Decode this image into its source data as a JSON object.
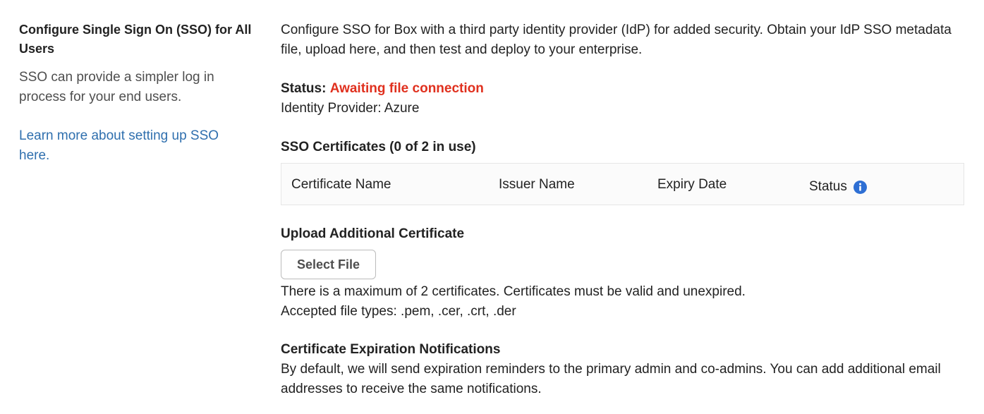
{
  "sidebar": {
    "title": "Configure Single Sign On (SSO) for All Users",
    "description": "SSO can provide a simpler log in process for your end users.",
    "learn_more_link": "Learn more about setting up SSO here."
  },
  "main": {
    "intro": "Configure SSO for Box with a third party identity provider (IdP) for added security. Obtain your IdP SSO metadata file, upload here, and then test and deploy to your enterprise.",
    "status": {
      "label": "Status:",
      "value": "Awaiting file connection",
      "value_color": "#e0301e"
    },
    "identity_provider": "Identity Provider: Azure",
    "certificates": {
      "heading": "SSO Certificates (0 of 2 in use)",
      "columns": {
        "name": "Certificate Name",
        "issuer": "Issuer Name",
        "expiry": "Expiry Date",
        "status": "Status"
      },
      "status_info_icon": "info-icon",
      "rows": []
    },
    "upload": {
      "heading": "Upload Additional Certificate",
      "button_label": "Select File",
      "max_note": "There is a maximum of 2 certificates. Certificates must be valid and unexpired.",
      "file_types": "Accepted file types: .pem, .cer, .crt, .der"
    },
    "notifications": {
      "heading": "Certificate Expiration Notifications",
      "text": "By default, we will send expiration reminders to the primary admin and co-admins. You can add additional email addresses to receive the same notifications."
    }
  },
  "colors": {
    "link": "#2f6fae",
    "status_warning": "#e0301e",
    "info_icon": "#2e6fd4"
  }
}
